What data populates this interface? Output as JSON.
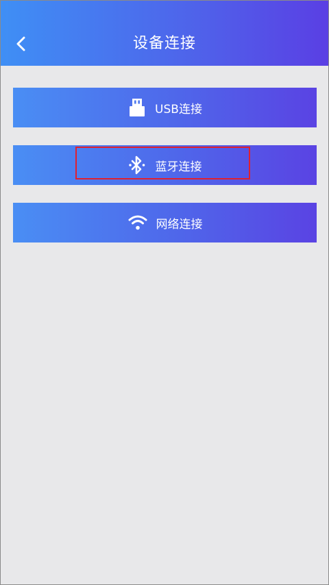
{
  "header": {
    "title": "设备连接",
    "back_icon": "chevron-left-icon"
  },
  "menu": {
    "items": [
      {
        "label": "USB连接",
        "icon": "usb-icon"
      },
      {
        "label": "蓝牙连接",
        "icon": "bluetooth-icon",
        "highlighted": true
      },
      {
        "label": "网络连接",
        "icon": "wifi-icon"
      }
    ]
  },
  "colors": {
    "gradient_start": "#3f8ff5",
    "gradient_end": "#5a3fe4",
    "background": "#e8e8ea",
    "highlight_border": "#e0202e",
    "text": "#ffffff"
  }
}
